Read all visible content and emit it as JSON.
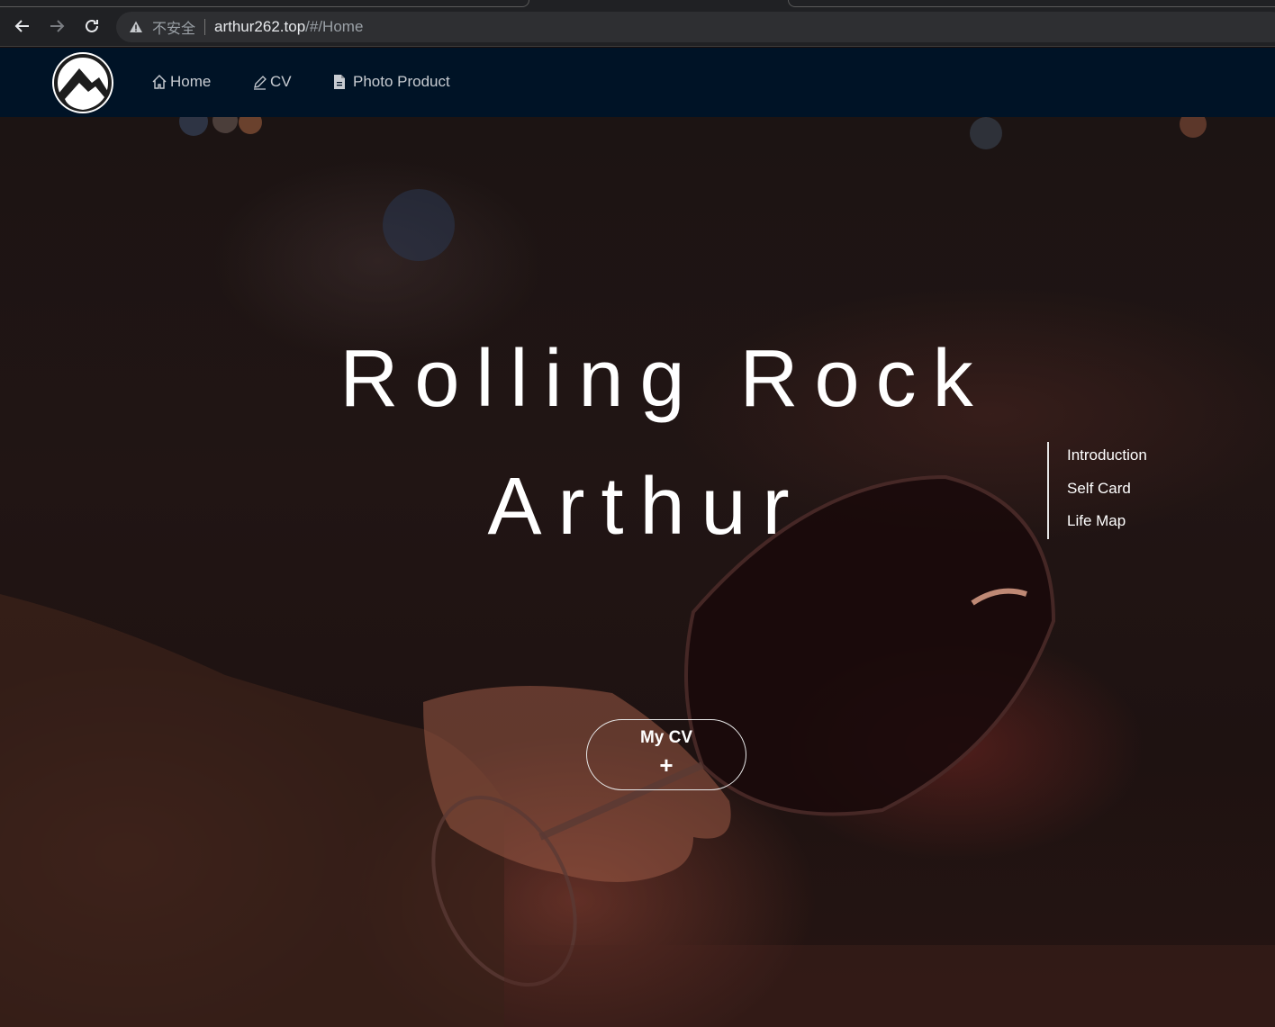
{
  "browser": {
    "insecure_label": "不安全",
    "url_host": "arthur262.top",
    "url_path": "/#/Home"
  },
  "nav": {
    "items": [
      {
        "label": "Home",
        "icon": "home-icon"
      },
      {
        "label": "CV",
        "icon": "pencil-icon"
      },
      {
        "label": "Photo Product",
        "icon": "document-icon"
      }
    ],
    "background": "#001326"
  },
  "hero": {
    "title_line1": "Rolling Rock",
    "title_line2": "Arthur",
    "side_menu": [
      "Introduction",
      "Self Card",
      "Life Map"
    ],
    "cv_button": {
      "label": "My CV",
      "symbol": "+"
    }
  }
}
